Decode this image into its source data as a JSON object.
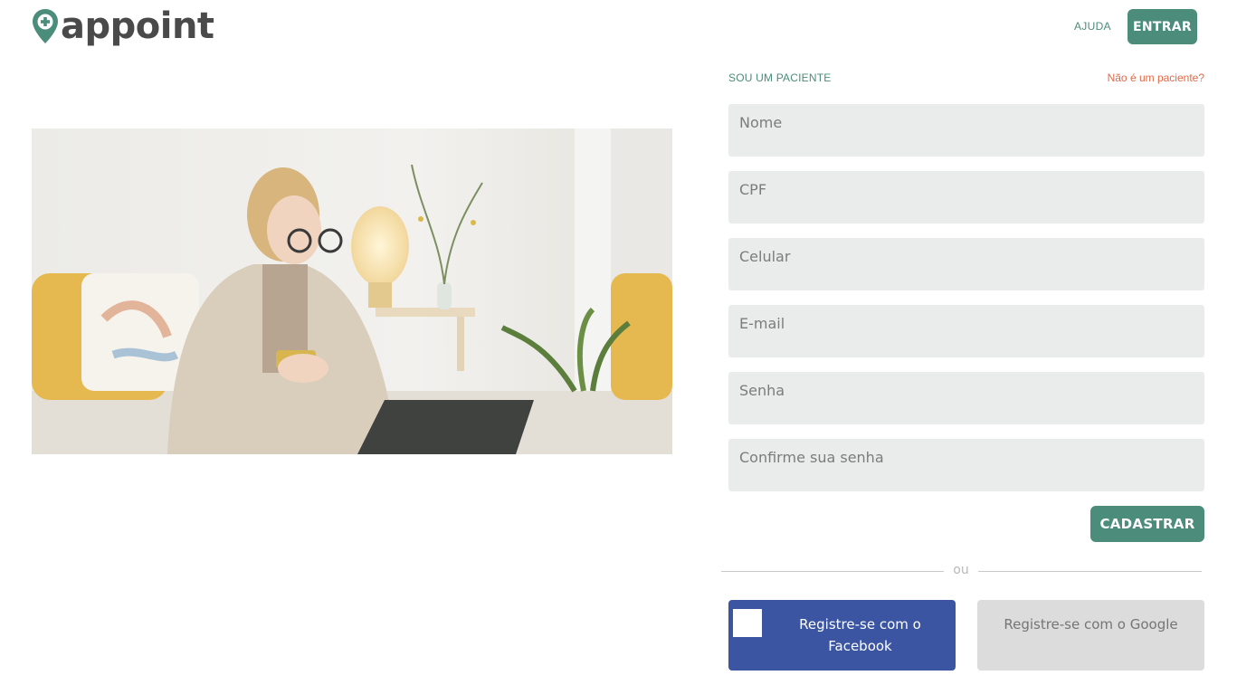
{
  "brand": {
    "name": "appoint",
    "icon": "location-pin-plus-icon",
    "color": "#4b8d7a"
  },
  "nav": {
    "help_label": "AJUDA",
    "login_label": "ENTRAR"
  },
  "hero": {
    "image": "woman-with-phone-on-bed-photo"
  },
  "form": {
    "role_label": "SOU UM PACIENTE",
    "not_patient_link": "Não é um paciente?",
    "fields": {
      "name": {
        "placeholder": "Nome",
        "value": ""
      },
      "cpf": {
        "placeholder": "CPF",
        "value": ""
      },
      "phone": {
        "placeholder": "Celular",
        "value": ""
      },
      "email": {
        "placeholder": "E-mail",
        "value": ""
      },
      "password": {
        "placeholder": "Senha",
        "value": ""
      },
      "password_confirm": {
        "placeholder": "Confirme sua senha",
        "value": ""
      }
    },
    "submit_label": "CADASTRAR"
  },
  "divider_text": "ou",
  "social": {
    "facebook_label": "Registre-se com o Facebook",
    "facebook_icon": "facebook-icon",
    "facebook_color": "#3b55a2",
    "google_label": "Registre-se com o Google"
  },
  "colors": {
    "accent": "#4b8d7a",
    "danger_link": "#e06a4a",
    "field_bg": "#e9ecea"
  }
}
